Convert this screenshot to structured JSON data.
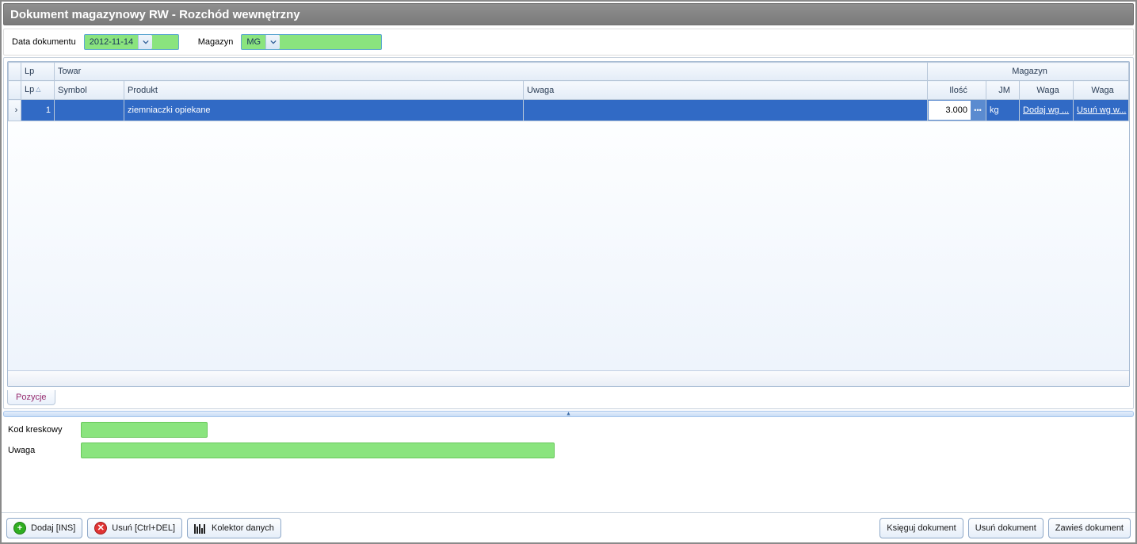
{
  "title": "Dokument magazynowy RW - Rozchód wewnętrzny",
  "form": {
    "date_label": "Data dokumentu",
    "date_value": "2012-11-14",
    "warehouse_label": "Magazyn",
    "warehouse_value": "MG"
  },
  "grid": {
    "group_headers": {
      "lp": "Lp",
      "towar": "Towar",
      "magazyn": "Magazyn"
    },
    "columns": {
      "lp": "Lp",
      "symbol": "Symbol",
      "produkt": "Produkt",
      "uwaga": "Uwaga",
      "ilosc": "Ilość",
      "jm": "JM",
      "waga1": "Waga",
      "waga2": "Waga"
    },
    "rows": [
      {
        "lp": "1",
        "symbol": "",
        "produkt": "ziemniaczki opiekane",
        "uwaga": "",
        "ilosc": "3.000",
        "jm": "kg",
        "waga1": "Dodaj wg ...",
        "waga2": "Usuń wg w..."
      }
    ],
    "tab": "Pozycje"
  },
  "bottom": {
    "barcode_label": "Kod kreskowy",
    "barcode_value": "",
    "note_label": "Uwaga",
    "note_value": ""
  },
  "footer": {
    "add": "Dodaj [INS]",
    "remove": "Usuń [Ctrl+DEL]",
    "collector": "Kolektor danych",
    "post": "Księguj dokument",
    "delete_doc": "Usuń dokument",
    "suspend": "Zawieś dokument"
  }
}
